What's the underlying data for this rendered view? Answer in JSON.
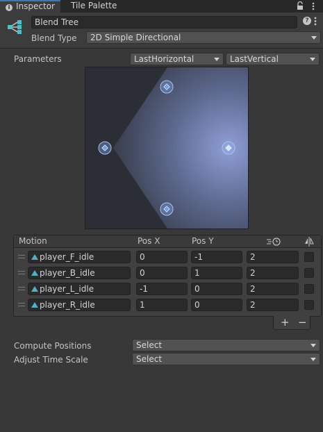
{
  "tabs": [
    {
      "label": "Inspector",
      "active": true
    },
    {
      "label": "Tile Palette",
      "active": false
    }
  ],
  "tab_icons": [
    "lock-icon",
    "menu-icon"
  ],
  "header": {
    "name_value": "Blend Tree",
    "help_glyph": "?",
    "blend_type_label": "Blend Type",
    "blend_type_value": "2D Simple Directional"
  },
  "parameters": {
    "label": "Parameters",
    "x_param": "LastHorizontal",
    "y_param": "LastVertical"
  },
  "graph": {
    "points": [
      {
        "x": 0,
        "y": 1
      },
      {
        "x": 0,
        "y": -1
      },
      {
        "x": -1,
        "y": 0
      },
      {
        "x": 1,
        "y": 0
      }
    ],
    "selected_point": {
      "x": 1,
      "y": 0
    },
    "colors": {
      "background": "#2b2e35",
      "highlight": "#8f9ed6",
      "point": "#6fa0f0"
    }
  },
  "motion_table": {
    "headers": {
      "motion": "Motion",
      "pos_x": "Pos X",
      "pos_y": "Pos Y"
    },
    "header_icons": [
      "time-scale-icon",
      "mirror-icon"
    ],
    "rows": [
      {
        "motion": "player_F_idle",
        "pos_x": "0",
        "pos_y": "-1",
        "speed": "2",
        "mirror": false
      },
      {
        "motion": "player_B_idle",
        "pos_x": "0",
        "pos_y": "1",
        "speed": "2",
        "mirror": false
      },
      {
        "motion": "player_L_idle",
        "pos_x": "-1",
        "pos_y": "0",
        "speed": "2",
        "mirror": false
      },
      {
        "motion": "player_R_idle",
        "pos_x": "1",
        "pos_y": "0",
        "speed": "2",
        "mirror": false
      }
    ],
    "add_glyph": "+",
    "remove_glyph": "−"
  },
  "compute_positions": {
    "label": "Compute Positions",
    "value": "Select"
  },
  "adjust_time_scale": {
    "label": "Adjust Time Scale",
    "value": "Select"
  },
  "accent_color": "#3a79bb"
}
